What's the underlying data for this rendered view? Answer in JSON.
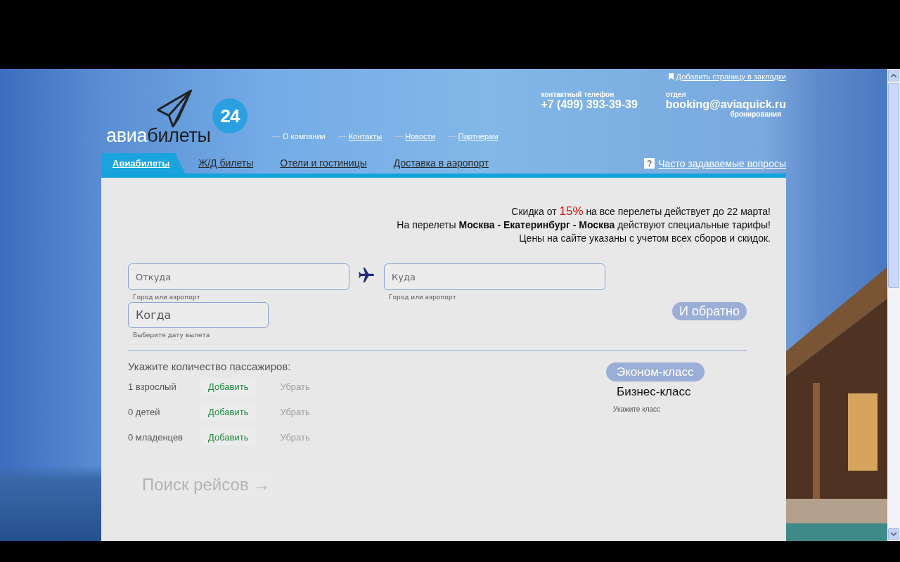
{
  "header": {
    "bookmark_link": "Добавить страницу в закладки",
    "logo": {
      "light_part": "авиа",
      "dark_part": "билеты",
      "badge": "24"
    },
    "site_nav": [
      {
        "label": "О компании",
        "selected": true
      },
      {
        "label": "Контакты",
        "selected": false
      },
      {
        "label": "Новости",
        "selected": false
      },
      {
        "label": "Партнерам",
        "selected": false
      }
    ],
    "contacts": [
      {
        "label": "контактный телефон",
        "value": "+7 (499) 393-39-39"
      },
      {
        "label": "отдел",
        "value": "booking@aviaquick.ru",
        "sublabel": "бронирования"
      }
    ]
  },
  "tabs": [
    {
      "label": "Авиабилеты",
      "selected": true
    },
    {
      "label": "Ж/Д билеты",
      "selected": false
    },
    {
      "label": "Отели и гостиницы",
      "selected": false
    },
    {
      "label": "Доставка в аэропорт",
      "selected": false
    }
  ],
  "faq_link": {
    "icon": "?",
    "label": "Часто задаваемые вопросы"
  },
  "promo": {
    "lines": [
      {
        "segments": [
          {
            "kind": "plain",
            "text": "Скидка от "
          },
          {
            "kind": "accent",
            "text": "15%"
          },
          {
            "kind": "plain",
            "text": " на все перелеты действует до 22 марта!"
          }
        ]
      },
      {
        "segments": [
          {
            "kind": "plain",
            "text": "На перелеты "
          },
          {
            "kind": "bold",
            "text": "Москва - Екатеринбург - Москва"
          },
          {
            "kind": "plain",
            "text": " действуют специальные тарифы!"
          }
        ]
      },
      {
        "segments": [
          {
            "kind": "plain",
            "text": "Цены на сайте указаны с учетом всех сборов и скидок."
          }
        ]
      }
    ]
  },
  "search_form": {
    "from": {
      "placeholder": "Откуда",
      "hint": "Город или аэропорт"
    },
    "to": {
      "placeholder": "Куда",
      "hint": "Город или аэропорт"
    },
    "date": {
      "placeholder": "Когда",
      "hint": "Выберите дату вылета"
    },
    "return_button": "И обратно"
  },
  "passengers": {
    "title": "Укажите количество пассажиров:",
    "rows": [
      {
        "count": "1 взрослый",
        "add_label": "Добавить",
        "remove_label": "Убрать",
        "remove_disabled": true
      },
      {
        "count": "0 детей",
        "add_label": "Добавить",
        "remove_label": "Убрать",
        "remove_disabled": true
      },
      {
        "count": "0 младенцев",
        "add_label": "Добавить",
        "remove_label": "Убрать",
        "remove_disabled": true
      }
    ]
  },
  "travel_class": {
    "options": [
      {
        "label": "Эконом-класс",
        "selected": true
      },
      {
        "label": "Бизнес-класс",
        "selected": false
      }
    ],
    "hint": "Укажите класс"
  },
  "search_button": {
    "label": "Поиск рейсов →",
    "disabled": true
  }
}
